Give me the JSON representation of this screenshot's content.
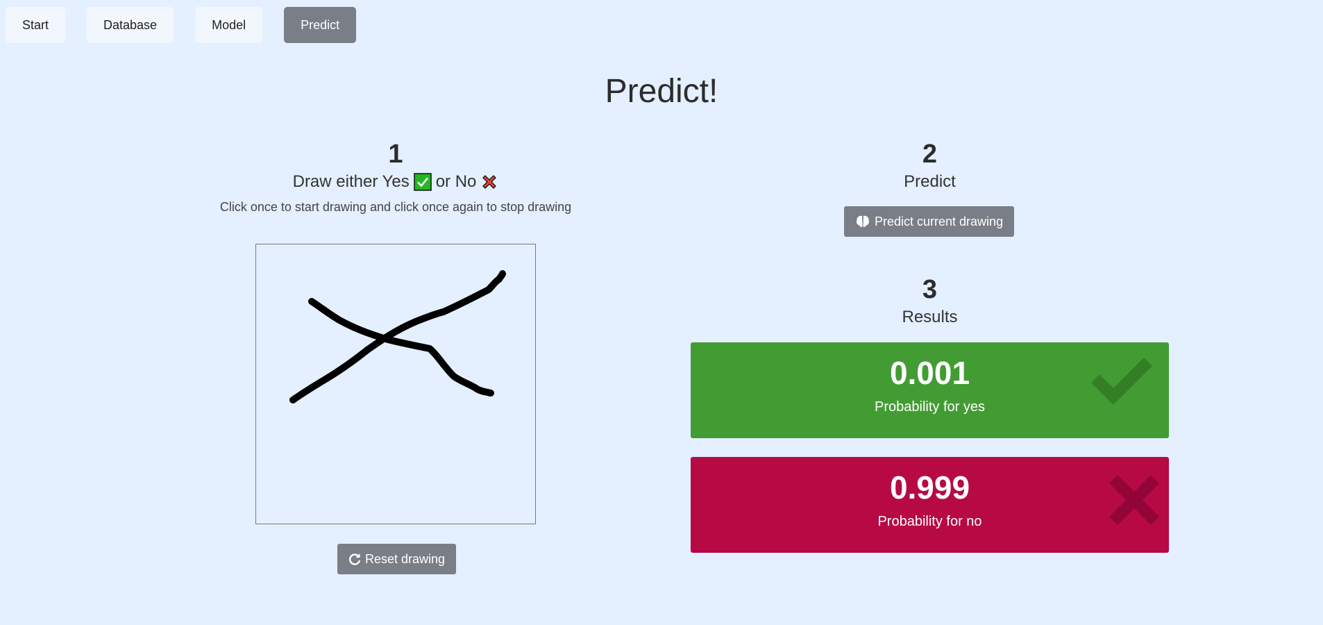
{
  "nav": {
    "tabs": [
      {
        "label": "Start"
      },
      {
        "label": "Database"
      },
      {
        "label": "Model"
      },
      {
        "label": "Predict"
      }
    ],
    "active": "Predict"
  },
  "page": {
    "title": "Predict!"
  },
  "step1": {
    "number": "1",
    "heading_prefix": "Draw either Yes",
    "heading_middle": "or No",
    "instruction": "Click once to start drawing and click once again to stop drawing",
    "reset_label": "Reset drawing"
  },
  "step2": {
    "number": "2",
    "heading": "Predict",
    "button_label": "Predict current drawing"
  },
  "step3": {
    "number": "3",
    "heading": "Results",
    "yes": {
      "value": "0.001",
      "label": "Probability for yes",
      "color": "#439c33"
    },
    "no": {
      "value": "0.999",
      "label": "Probability for no",
      "color": "#b70a45"
    }
  },
  "icons": {
    "yes": "check-icon",
    "no": "cross-icon",
    "predict": "brain-icon",
    "reset": "refresh-icon"
  }
}
